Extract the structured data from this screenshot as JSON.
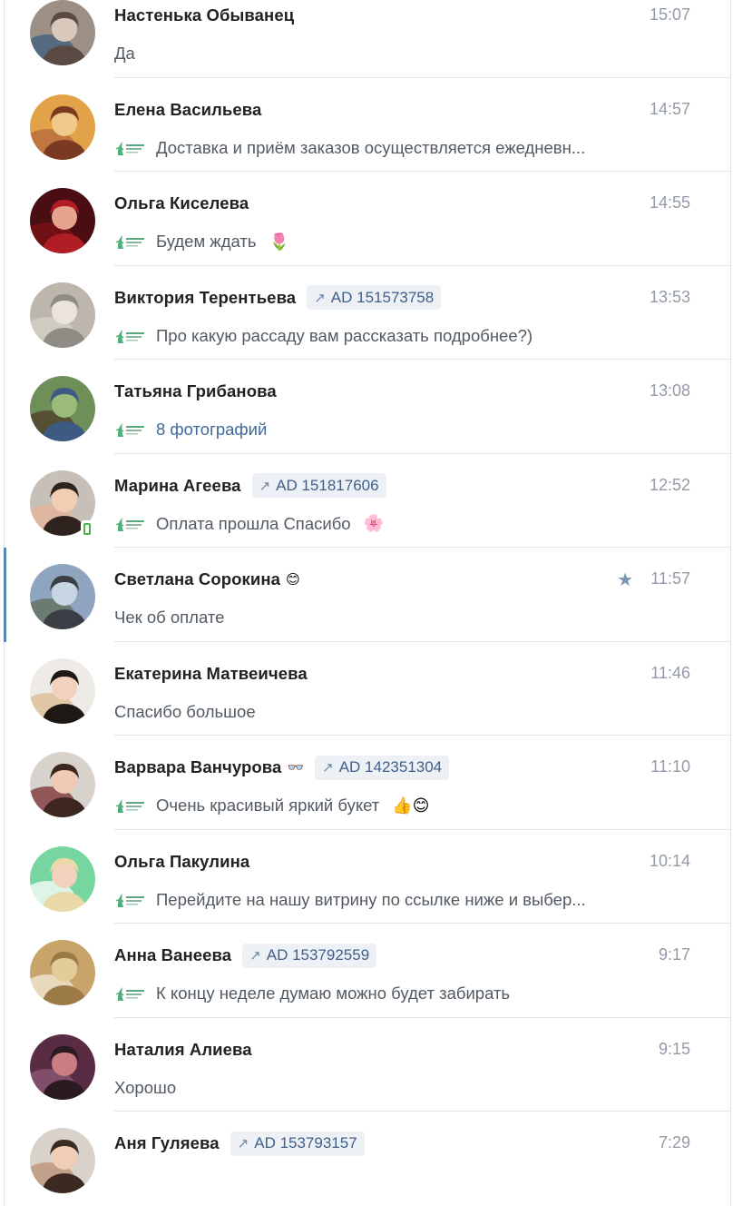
{
  "dialogs": [
    {
      "name": "Настенька Обыванец",
      "name_emoji": "",
      "ad": "",
      "time": "15:07",
      "brand": false,
      "message": "Да",
      "message_emoji": "",
      "link": false,
      "starred": false,
      "selected": false,
      "mobile": false,
      "avatar": {
        "bg": "#9c8f86",
        "c1": "#d9c8bb",
        "c2": "#5b4a44",
        "c3": "#3e5d7e"
      }
    },
    {
      "name": "Елена Васильева",
      "name_emoji": "",
      "ad": "",
      "time": "14:57",
      "brand": true,
      "message": "Доставка и приём заказов осуществляется ежедневн...",
      "message_emoji": "",
      "link": false,
      "starred": false,
      "selected": false,
      "mobile": false,
      "avatar": {
        "bg": "#e2a24a",
        "c1": "#f0c98c",
        "c2": "#7a3a22",
        "c3": "#b5673d"
      }
    },
    {
      "name": "Ольга Киселева",
      "name_emoji": "",
      "ad": "",
      "time": "14:55",
      "brand": true,
      "message": "Будем ждать",
      "message_emoji": "🌷",
      "link": false,
      "starred": false,
      "selected": false,
      "mobile": false,
      "avatar": {
        "bg": "#4a0e12",
        "c1": "#e6a38e",
        "c2": "#b01d24",
        "c3": "#7e1318"
      }
    },
    {
      "name": "Виктория Терентьева",
      "name_emoji": "",
      "ad": "AD 151573758",
      "time": "13:53",
      "brand": true,
      "message": "Про какую рассаду вам рассказать подробнее?)",
      "message_emoji": "",
      "link": false,
      "starred": false,
      "selected": false,
      "mobile": false,
      "avatar": {
        "bg": "#bcb6ad",
        "c1": "#eae4dc",
        "c2": "#8f8c86",
        "c3": "#d7d1c8"
      }
    },
    {
      "name": "Татьяна Грибанова",
      "name_emoji": "",
      "ad": "",
      "time": "13:08",
      "brand": true,
      "message": "8 фотографий",
      "message_emoji": "",
      "link": true,
      "starred": false,
      "selected": false,
      "mobile": false,
      "avatar": {
        "bg": "#6f8f58",
        "c1": "#9bbb7a",
        "c2": "#3c5a82",
        "c3": "#4b3a2a"
      }
    },
    {
      "name": "Марина Агеева",
      "name_emoji": "",
      "ad": "AD 151817606",
      "time": "12:52",
      "brand": true,
      "message": "Оплата прошла Спасибо",
      "message_emoji": "🌸",
      "link": false,
      "starred": false,
      "selected": false,
      "mobile": true,
      "avatar": {
        "bg": "#c7c0b8",
        "c1": "#f1cdb3",
        "c2": "#2e231e",
        "c3": "#e7b49a"
      }
    },
    {
      "name": "Светлана Сорокина",
      "name_emoji": "😊",
      "ad": "",
      "time": "11:57",
      "brand": false,
      "message": "Чек об оплате",
      "message_emoji": "",
      "link": false,
      "starred": true,
      "selected": true,
      "mobile": false,
      "avatar": {
        "bg": "#8ea4bf",
        "c1": "#c8d5e3",
        "c2": "#3b3f45",
        "c3": "#5f6d57"
      }
    },
    {
      "name": "Екатерина Матвеичева",
      "name_emoji": "",
      "ad": "",
      "time": "11:46",
      "brand": false,
      "message": "Спасибо большое",
      "message_emoji": "",
      "link": false,
      "starred": false,
      "selected": false,
      "mobile": false,
      "avatar": {
        "bg": "#eeeae6",
        "c1": "#f2d1bd",
        "c2": "#1e1814",
        "c3": "#d9b98f"
      }
    },
    {
      "name": "Варвара Ванчурова",
      "name_emoji": "👓",
      "ad": "AD 142351304",
      "time": "11:10",
      "brand": true,
      "message": "Очень красивый яркий букет",
      "message_emoji": "👍😊",
      "link": false,
      "starred": false,
      "selected": false,
      "mobile": false,
      "avatar": {
        "bg": "#d8d2cc",
        "c1": "#efcab4",
        "c2": "#3c261d",
        "c3": "#7a2e33"
      }
    },
    {
      "name": "Ольга Пакулина",
      "name_emoji": "",
      "ad": "",
      "time": "10:14",
      "brand": true,
      "message": "Перейдите на нашу витрину по ссылке ниже и выбер...",
      "message_emoji": "",
      "link": false,
      "starred": false,
      "selected": false,
      "mobile": false,
      "avatar": {
        "bg": "#77d6a0",
        "c1": "#f3d2bd",
        "c2": "#e9d9a8",
        "c3": "#ffffff"
      }
    },
    {
      "name": "Анна Ванеева",
      "name_emoji": "",
      "ad": "AD 153792559",
      "time": "9:17",
      "brand": true,
      "message": "К концу неделе думаю можно будет забирать",
      "message_emoji": "",
      "link": false,
      "starred": false,
      "selected": false,
      "mobile": false,
      "avatar": {
        "bg": "#c9a46a",
        "c1": "#e4cc99",
        "c2": "#9c7a45",
        "c3": "#f2ead8"
      }
    },
    {
      "name": "Наталия Алиева",
      "name_emoji": "",
      "ad": "",
      "time": "9:15",
      "brand": false,
      "message": "Хорошо",
      "message_emoji": "",
      "link": false,
      "starred": false,
      "selected": false,
      "mobile": false,
      "avatar": {
        "bg": "#5a2c44",
        "c1": "#c97e83",
        "c2": "#2b1a22",
        "c3": "#8d5a78"
      }
    },
    {
      "name": "Аня Гуляева",
      "name_emoji": "",
      "ad": "AD 153793157",
      "time": "7:29",
      "brand": false,
      "message": "",
      "message_emoji": "",
      "link": false,
      "starred": false,
      "selected": false,
      "mobile": false,
      "avatar": {
        "bg": "#d9d2ca",
        "c1": "#f0cdb7",
        "c2": "#3a2a22",
        "c3": "#b98f74"
      }
    }
  ],
  "brand_icon": "flowers-shop-logo-icon",
  "ad_icon": "arrow-up-right-icon",
  "star_icon": "star-icon"
}
